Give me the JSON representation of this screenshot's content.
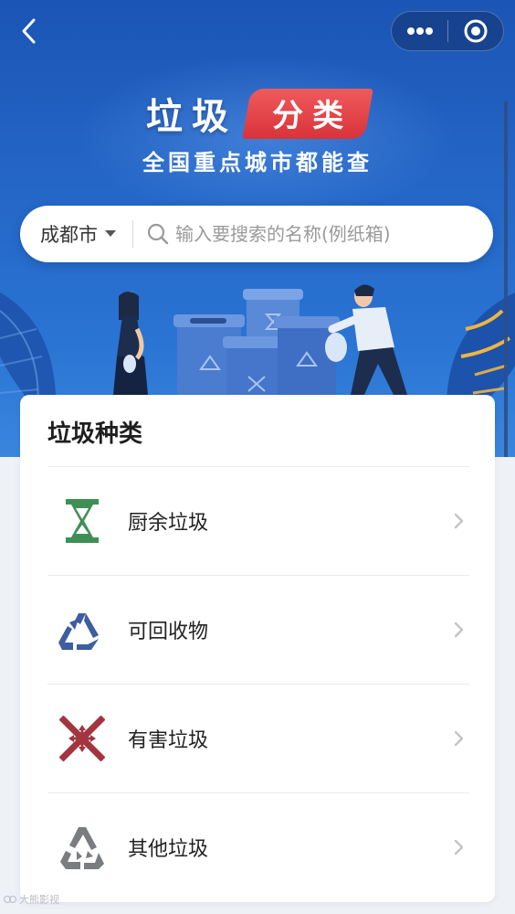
{
  "nav": {
    "back_icon": "chevron-left-icon",
    "more_icon": "more-dots-icon",
    "close_icon": "target-circle-icon"
  },
  "header": {
    "title": "垃圾",
    "title_tag": "分类",
    "subtitle": "全国重点城市都能查"
  },
  "search": {
    "city": "成都市",
    "placeholder": "输入要搜索的名称(例纸箱)"
  },
  "categories": {
    "heading": "垃圾种类",
    "items": [
      {
        "label": "厨余垃圾",
        "icon": "hourglass-icon",
        "color": "#3f8f55"
      },
      {
        "label": "可回收物",
        "icon": "recycle-icon",
        "color": "#3d5ea0"
      },
      {
        "label": "有害垃圾",
        "icon": "hazard-cross-icon",
        "color": "#a3353f"
      },
      {
        "label": "其他垃圾",
        "icon": "recycle-icon",
        "color": "#7a7d80"
      }
    ]
  },
  "watermark": "大熊影视",
  "colors": {
    "hero_blue": "#2466c6",
    "tag_red": "#d8333a",
    "card_bg": "#ffffff"
  }
}
